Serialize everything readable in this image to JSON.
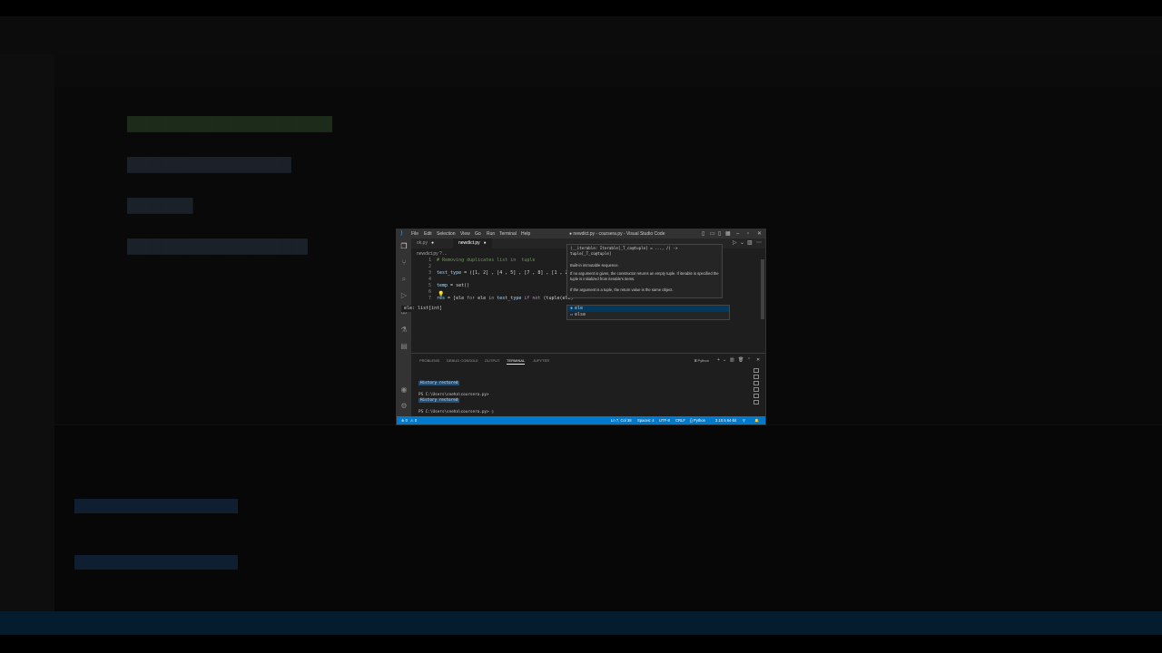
{
  "window": {
    "title": "● newdict.py - coursera.py - Visual Studio Code",
    "menu": [
      "File",
      "Edit",
      "Selection",
      "View",
      "Go",
      "Run",
      "Terminal",
      "Help"
    ]
  },
  "tabs": [
    {
      "label": "ok.py",
      "dirty": true
    },
    {
      "label": "newdict.py",
      "dirty": true
    }
  ],
  "breadcrumb": "newdict.py ? ...",
  "editor": {
    "line_numbers": [
      "1",
      "2",
      "3",
      "4",
      "5",
      "6",
      "7"
    ],
    "lines": {
      "l1": "# Removing duplicates list in  tuple",
      "l3_var": "test_type",
      "l3_rest": " = ([1, 2] , [4 , 5] , [7 , 8] , [1 , 2]",
      "l5_var": "temp",
      "l5_eq": " = ",
      "l5_fn": "set",
      "l5_paren": "()",
      "l7_var": "res",
      "l7_a": " = [ele ",
      "l7_for": "for",
      "l7_b": " ele ",
      "l7_in": "in",
      "l7_c": " test_type ",
      "l7_if": "if",
      "l7_not": " not",
      "l7_d": " (tuple(ele)"
    },
    "inlay_hint": "ele: list[int]"
  },
  "hover": {
    "signature": "(__iterable: Iterable[_T_co@tuple] = ..., /) -> tuple[_T_co@tuple]",
    "line1": "Built-in immutable sequence.",
    "line2": "If no argument is given, the constructor returns an empty tuple. If iterable is specified the tuple is initialized from iterable's items.",
    "line3": "If the argument is a tuple, the return value is the same object."
  },
  "suggestions": [
    {
      "label": "ele",
      "icon": "variable-icon",
      "selected": true
    },
    {
      "label": "else",
      "icon": "keyword-icon",
      "selected": false
    }
  ],
  "panel": {
    "tabs": [
      "PROBLEMS",
      "DEBUG CONSOLE",
      "OUTPUT",
      "TERMINAL",
      "JUPYTER"
    ],
    "active_tab": "TERMINAL",
    "shell_label": "Python",
    "terminal": {
      "history1": "History restored",
      "prompt1": "PS C:\\Users\\sneha\\coursera.py>",
      "history2": "History restored",
      "prompt2": "PS C:\\Users\\sneha\\coursera.py> "
    }
  },
  "status": {
    "errors": "⊗ 0",
    "warnings": "⚠ 0",
    "position": "Ln 7, Col 38",
    "spaces": "Spaces: 4",
    "encoding": "UTF-8",
    "eol": "CRLF",
    "language": "{} Python",
    "interpreter": "3.10.5 64-bit"
  },
  "colors": {
    "accent": "#007acc",
    "selection": "#04395e",
    "terminal_badge": "#264f78"
  }
}
